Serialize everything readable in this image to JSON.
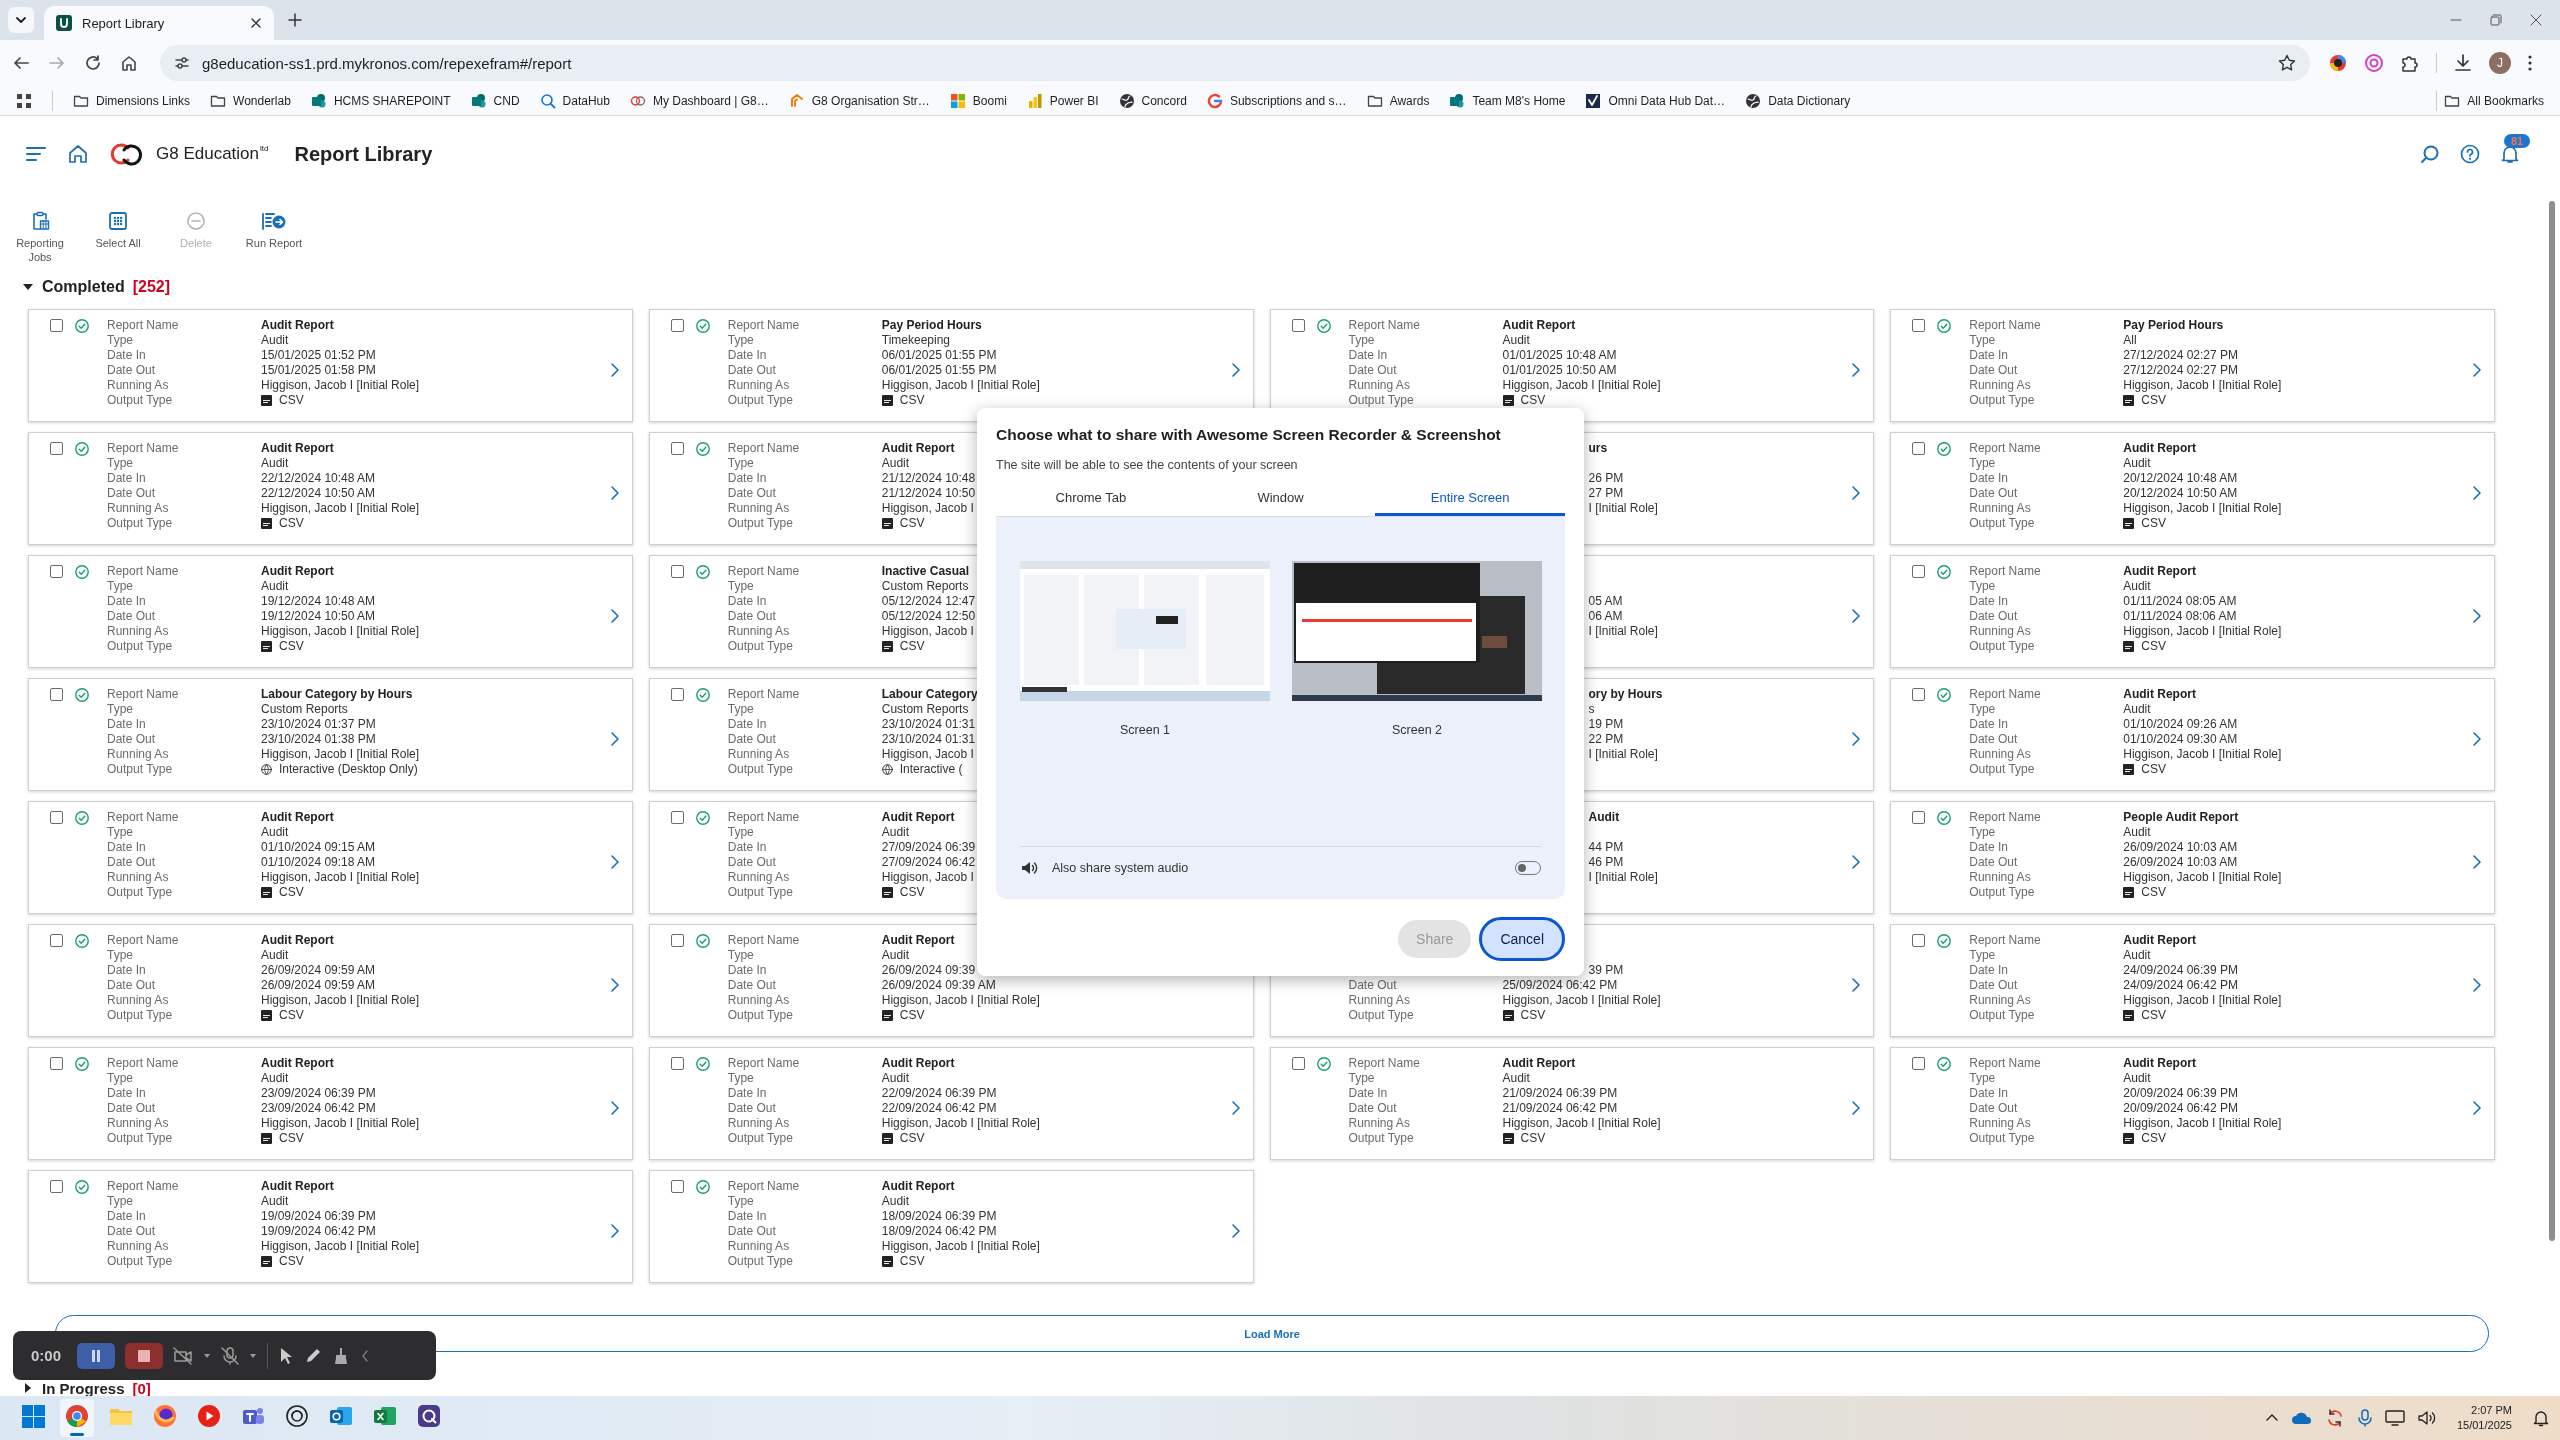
{
  "browser": {
    "tabs": [
      {
        "title": "Report Library",
        "selected": true
      }
    ],
    "url": "g8education-ss1.prd.mykronos.com/repexefram#/report",
    "profile_initial": "J",
    "bookmarks": [
      {
        "label": "Dimensions Links",
        "kind": "folder"
      },
      {
        "label": "Wonderlab",
        "kind": "folder"
      },
      {
        "label": "HCMS SHAREPOINT",
        "kind": "circles"
      },
      {
        "label": "CND",
        "kind": "circles"
      },
      {
        "label": "DataHub",
        "kind": "search"
      },
      {
        "label": "My Dashboard | G8…",
        "kind": "rings"
      },
      {
        "label": "G8 Organisation Str…",
        "kind": "chevron"
      },
      {
        "label": "Boomi",
        "kind": "squares"
      },
      {
        "label": "Power BI",
        "kind": "bars"
      },
      {
        "label": "Concord",
        "kind": "globe"
      },
      {
        "label": "Subscriptions and s…",
        "kind": "ring"
      },
      {
        "label": "Awards",
        "kind": "folder"
      },
      {
        "label": "Team M8's Home",
        "kind": "circles"
      },
      {
        "label": "Omni Data Hub Dat…",
        "kind": "checkmark"
      },
      {
        "label": "Data Dictionary",
        "kind": "globe"
      }
    ],
    "all_bookmarks": "All Bookmarks"
  },
  "app": {
    "brand": "G8 Education",
    "brand_suffix": "ltd",
    "title": "Report Library",
    "notification_count": "81"
  },
  "toolbar": [
    {
      "label": "Reporting Jobs",
      "kind": "jobs",
      "disabled": false
    },
    {
      "label": "Select All",
      "kind": "select-all",
      "disabled": false
    },
    {
      "label": "Delete",
      "kind": "delete",
      "disabled": true
    },
    {
      "label": "Run Report",
      "kind": "run",
      "disabled": false
    }
  ],
  "completed": {
    "title": "Completed",
    "count": "[252]",
    "expanded": true,
    "cards": [
      {
        "kind": "full",
        "checked": false,
        "done": true,
        "arrow": true,
        "fields": [
          {
            "label": "Report Name",
            "value": "Audit Report"
          },
          {
            "label": "Type",
            "value": "Audit"
          },
          {
            "label": "Date In",
            "value": "15/01/2025 01:52 PM"
          },
          {
            "label": "Date Out",
            "value": "15/01/2025 01:58 PM"
          },
          {
            "label": "Running As",
            "value": "Higgison, Jacob I [Initial Role]"
          },
          {
            "label": "Output Type",
            "value": "CSV",
            "kind": "csv"
          }
        ]
      },
      {
        "kind": "full",
        "checked": false,
        "done": true,
        "arrow": true,
        "fields": [
          {
            "label": "Report Name",
            "value": "Pay Period Hours"
          },
          {
            "label": "Type",
            "value": "Timekeeping"
          },
          {
            "label": "Date In",
            "value": "06/01/2025 01:55 PM"
          },
          {
            "label": "Date Out",
            "value": "06/01/2025 01:55 PM"
          },
          {
            "label": "Running As",
            "value": "Higgison, Jacob I [Initial Role]"
          },
          {
            "label": "Output Type",
            "value": "CSV",
            "kind": "csv"
          }
        ]
      },
      {
        "kind": "full",
        "checked": false,
        "done": true,
        "arrow": true,
        "fields": [
          {
            "label": "Report Name",
            "value": "Audit Report"
          },
          {
            "label": "Type",
            "value": "Audit"
          },
          {
            "label": "Date In",
            "value": "01/01/2025 10:48 AM"
          },
          {
            "label": "Date Out",
            "value": "01/01/2025 10:50 AM"
          },
          {
            "label": "Running As",
            "value": "Higgison, Jacob I [Initial Role]"
          },
          {
            "label": "Output Type",
            "value": "CSV",
            "kind": "csv"
          }
        ]
      },
      {
        "kind": "full",
        "checked": false,
        "done": true,
        "arrow": true,
        "fields": [
          {
            "label": "Report Name",
            "value": "Pay Period Hours"
          },
          {
            "label": "Type",
            "value": "All"
          },
          {
            "label": "Date In",
            "value": "27/12/2024 02:27 PM"
          },
          {
            "label": "Date Out",
            "value": "27/12/2024 02:27 PM"
          },
          {
            "label": "Running As",
            "value": "Higgison, Jacob I [Initial Role]"
          },
          {
            "label": "Output Type",
            "value": "CSV",
            "kind": "csv"
          }
        ]
      },
      {
        "kind": "full",
        "checked": false,
        "done": true,
        "arrow": true,
        "fields": [
          {
            "label": "Report Name",
            "value": "Audit Report"
          },
          {
            "label": "Type",
            "value": "Audit"
          },
          {
            "label": "Date In",
            "value": "22/12/2024 10:48 AM"
          },
          {
            "label": "Date Out",
            "value": "22/12/2024 10:50 AM"
          },
          {
            "label": "Running As",
            "value": "Higgison, Jacob I [Initial Role]"
          },
          {
            "label": "Output Type",
            "value": "CSV",
            "kind": "csv"
          }
        ]
      },
      {
        "kind": "full",
        "checked": false,
        "done": true,
        "arrow": false,
        "fields": [
          {
            "label": "Report Name",
            "value": "Audit Report"
          },
          {
            "label": "Type",
            "value": "Audit"
          },
          {
            "label": "Date In",
            "value": "21/12/2024 10:48"
          },
          {
            "label": "Date Out",
            "value": "21/12/2024 10:50"
          },
          {
            "label": "Running As",
            "value": "Higgison, Jacob I"
          },
          {
            "label": "Output Type",
            "value": "CSV",
            "kind": "csv"
          }
        ]
      },
      {
        "kind": "partial",
        "arrow": true,
        "fields": [
          {
            "kind": "fragment",
            "value": "urs"
          },
          {
            "kind": "hidden"
          },
          {
            "kind": "fragment",
            "value": "26 PM"
          },
          {
            "kind": "fragment",
            "value": "27 PM"
          },
          {
            "kind": "fragment",
            "value": "I [Initial Role]"
          }
        ]
      },
      {
        "kind": "full",
        "checked": false,
        "done": true,
        "arrow": true,
        "fields": [
          {
            "label": "Report Name",
            "value": "Audit Report"
          },
          {
            "label": "Type",
            "value": "Audit"
          },
          {
            "label": "Date In",
            "value": "20/12/2024 10:48 AM"
          },
          {
            "label": "Date Out",
            "value": "20/12/2024 10:50 AM"
          },
          {
            "label": "Running As",
            "value": "Higgison, Jacob I [Initial Role]"
          },
          {
            "label": "Output Type",
            "value": "CSV",
            "kind": "csv"
          }
        ]
      },
      {
        "kind": "full",
        "checked": false,
        "done": true,
        "arrow": true,
        "fields": [
          {
            "label": "Report Name",
            "value": "Audit Report"
          },
          {
            "label": "Type",
            "value": "Audit"
          },
          {
            "label": "Date In",
            "value": "19/12/2024 10:48 AM"
          },
          {
            "label": "Date Out",
            "value": "19/12/2024 10:50 AM"
          },
          {
            "label": "Running As",
            "value": "Higgison, Jacob I [Initial Role]"
          },
          {
            "label": "Output Type",
            "value": "CSV",
            "kind": "csv"
          }
        ]
      },
      {
        "kind": "full",
        "checked": false,
        "done": true,
        "arrow": false,
        "fields": [
          {
            "label": "Report Name",
            "value": "Inactive Casual"
          },
          {
            "label": "Type",
            "value": "Custom Reports"
          },
          {
            "label": "Date In",
            "value": "05/12/2024 12:47"
          },
          {
            "label": "Date Out",
            "value": "05/12/2024 12:50"
          },
          {
            "label": "Running As",
            "value": "Higgison, Jacob I"
          },
          {
            "label": "Output Type",
            "value": "CSV",
            "kind": "csv"
          }
        ]
      },
      {
        "kind": "partial",
        "arrow": true,
        "fields": [
          {
            "kind": "hidden"
          },
          {
            "kind": "hidden"
          },
          {
            "kind": "fragment",
            "value": "05 AM"
          },
          {
            "kind": "fragment",
            "value": "06 AM"
          },
          {
            "kind": "fragment",
            "value": "I [Initial Role]"
          }
        ]
      },
      {
        "kind": "full",
        "checked": false,
        "done": true,
        "arrow": true,
        "fields": [
          {
            "label": "Report Name",
            "value": "Audit Report"
          },
          {
            "label": "Type",
            "value": "Audit"
          },
          {
            "label": "Date In",
            "value": "01/11/2024 08:05 AM"
          },
          {
            "label": "Date Out",
            "value": "01/11/2024 08:06 AM"
          },
          {
            "label": "Running As",
            "value": "Higgison, Jacob I [Initial Role]"
          },
          {
            "label": "Output Type",
            "value": "CSV",
            "kind": "csv"
          }
        ]
      },
      {
        "kind": "full",
        "checked": false,
        "done": true,
        "arrow": true,
        "fields": [
          {
            "label": "Report Name",
            "value": "Labour Category by Hours"
          },
          {
            "label": "Type",
            "value": "Custom Reports"
          },
          {
            "label": "Date In",
            "value": "23/10/2024 01:37 PM"
          },
          {
            "label": "Date Out",
            "value": "23/10/2024 01:38 PM"
          },
          {
            "label": "Running As",
            "value": "Higgison, Jacob I [Initial Role]"
          },
          {
            "label": "Output Type",
            "value": "Interactive (Desktop Only)",
            "kind": "interactive"
          }
        ]
      },
      {
        "kind": "full",
        "checked": false,
        "done": true,
        "arrow": false,
        "fields": [
          {
            "label": "Report Name",
            "value": "Labour Category"
          },
          {
            "label": "Type",
            "value": "Custom Reports"
          },
          {
            "label": "Date In",
            "value": "23/10/2024 01:31"
          },
          {
            "label": "Date Out",
            "value": "23/10/2024 01:31"
          },
          {
            "label": "Running As",
            "value": "Higgison, Jacob I"
          },
          {
            "label": "Output Type",
            "value": "Interactive (",
            "kind": "interactive"
          }
        ]
      },
      {
        "kind": "partial",
        "arrow": true,
        "fields": [
          {
            "kind": "fragment",
            "value": "ory by Hours"
          },
          {
            "kind": "fragment",
            "value": "s"
          },
          {
            "kind": "fragment",
            "value": "19 PM"
          },
          {
            "kind": "fragment",
            "value": "22 PM"
          },
          {
            "kind": "fragment",
            "value": "I [Initial Role]"
          }
        ]
      },
      {
        "kind": "full",
        "checked": false,
        "done": true,
        "arrow": true,
        "fields": [
          {
            "label": "Report Name",
            "value": "Audit Report"
          },
          {
            "label": "Type",
            "value": "Audit"
          },
          {
            "label": "Date In",
            "value": "01/10/2024 09:26 AM"
          },
          {
            "label": "Date Out",
            "value": "01/10/2024 09:30 AM"
          },
          {
            "label": "Running As",
            "value": "Higgison, Jacob I [Initial Role]"
          },
          {
            "label": "Output Type",
            "value": "CSV",
            "kind": "csv"
          }
        ]
      },
      {
        "kind": "full",
        "checked": false,
        "done": true,
        "arrow": true,
        "fields": [
          {
            "label": "Report Name",
            "value": "Audit Report"
          },
          {
            "label": "Type",
            "value": "Audit"
          },
          {
            "label": "Date In",
            "value": "01/10/2024 09:15 AM"
          },
          {
            "label": "Date Out",
            "value": "01/10/2024 09:18 AM"
          },
          {
            "label": "Running As",
            "value": "Higgison, Jacob I [Initial Role]"
          },
          {
            "label": "Output Type",
            "value": "CSV",
            "kind": "csv"
          }
        ]
      },
      {
        "kind": "full",
        "checked": false,
        "done": true,
        "arrow": false,
        "fields": [
          {
            "label": "Report Name",
            "value": "Audit Report"
          },
          {
            "label": "Type",
            "value": "Audit"
          },
          {
            "label": "Date In",
            "value": "27/09/2024 06:39"
          },
          {
            "label": "Date Out",
            "value": "27/09/2024 06:42"
          },
          {
            "label": "Running As",
            "value": "Higgison, Jacob I"
          },
          {
            "label": "Output Type",
            "value": "CSV",
            "kind": "csv"
          }
        ]
      },
      {
        "kind": "partial",
        "arrow": true,
        "fields": [
          {
            "kind": "fragment",
            "value": "Audit"
          },
          {
            "kind": "hidden"
          },
          {
            "kind": "fragment",
            "value": "44 PM"
          },
          {
            "kind": "fragment",
            "value": "46 PM"
          },
          {
            "kind": "fragment",
            "value": "I [Initial Role]"
          }
        ]
      },
      {
        "kind": "full",
        "checked": false,
        "done": true,
        "arrow": true,
        "fields": [
          {
            "label": "Report Name",
            "value": "People Audit Report"
          },
          {
            "label": "Type",
            "value": "Audit"
          },
          {
            "label": "Date In",
            "value": "26/09/2024 10:03 AM"
          },
          {
            "label": "Date Out",
            "value": "26/09/2024 10:03 AM"
          },
          {
            "label": "Running As",
            "value": "Higgison, Jacob I [Initial Role]"
          },
          {
            "label": "Output Type",
            "value": "CSV",
            "kind": "csv"
          }
        ]
      },
      {
        "kind": "full",
        "checked": false,
        "done": true,
        "arrow": true,
        "fields": [
          {
            "label": "Report Name",
            "value": "Audit Report"
          },
          {
            "label": "Type",
            "value": "Audit"
          },
          {
            "label": "Date In",
            "value": "26/09/2024 09:59 AM"
          },
          {
            "label": "Date Out",
            "value": "26/09/2024 09:59 AM"
          },
          {
            "label": "Running As",
            "value": "Higgison, Jacob I [Initial Role]"
          },
          {
            "label": "Output Type",
            "value": "CSV",
            "kind": "csv"
          }
        ]
      },
      {
        "kind": "full",
        "checked": false,
        "done": true,
        "arrow": false,
        "fields": [
          {
            "label": "Report Name",
            "value": "Audit Report"
          },
          {
            "label": "Type",
            "value": "Audit"
          },
          {
            "label": "Date In",
            "value": "26/09/2024 09:39"
          },
          {
            "label": "Date Out",
            "value": "26/09/2024 09:39 AM"
          },
          {
            "label": "Running As",
            "value": "Higgison, Jacob I [Initial Role]"
          },
          {
            "label": "Output Type",
            "value": "CSV",
            "kind": "csv"
          }
        ]
      },
      {
        "kind": "partial",
        "arrow": true,
        "fields": [
          {
            "kind": "hidden"
          },
          {
            "kind": "hidden"
          },
          {
            "kind": "fragment",
            "value": "39 PM"
          },
          {
            "kind": "full",
            "label": "Date Out",
            "value": "25/09/2024 06:42 PM"
          },
          {
            "kind": "full",
            "label": "Running As",
            "value": "Higgison, Jacob I [Initial Role]"
          },
          {
            "kind": "csv",
            "label": "Output Type",
            "value": "CSV"
          }
        ]
      },
      {
        "kind": "full",
        "checked": false,
        "done": true,
        "arrow": true,
        "fields": [
          {
            "label": "Report Name",
            "value": "Audit Report"
          },
          {
            "label": "Type",
            "value": "Audit"
          },
          {
            "label": "Date In",
            "value": "24/09/2024 06:39 PM"
          },
          {
            "label": "Date Out",
            "value": "24/09/2024 06:42 PM"
          },
          {
            "label": "Running As",
            "value": "Higgison, Jacob I [Initial Role]"
          },
          {
            "label": "Output Type",
            "value": "CSV",
            "kind": "csv"
          }
        ]
      },
      {
        "kind": "full",
        "checked": false,
        "done": true,
        "arrow": true,
        "fields": [
          {
            "label": "Report Name",
            "value": "Audit Report"
          },
          {
            "label": "Type",
            "value": "Audit"
          },
          {
            "label": "Date In",
            "value": "23/09/2024 06:39 PM"
          },
          {
            "label": "Date Out",
            "value": "23/09/2024 06:42 PM"
          },
          {
            "label": "Running As",
            "value": "Higgison, Jacob I [Initial Role]"
          },
          {
            "label": "Output Type",
            "value": "CSV",
            "kind": "csv"
          }
        ]
      },
      {
        "kind": "full",
        "checked": false,
        "done": true,
        "arrow": true,
        "fields": [
          {
            "label": "Report Name",
            "value": "Audit Report"
          },
          {
            "label": "Type",
            "value": "Audit"
          },
          {
            "label": "Date In",
            "value": "22/09/2024 06:39 PM"
          },
          {
            "label": "Date Out",
            "value": "22/09/2024 06:42 PM"
          },
          {
            "label": "Running As",
            "value": "Higgison, Jacob I [Initial Role]"
          },
          {
            "label": "Output Type",
            "value": "CSV",
            "kind": "csv"
          }
        ]
      },
      {
        "kind": "full",
        "checked": false,
        "done": true,
        "arrow": true,
        "fields": [
          {
            "label": "Report Name",
            "value": "Audit Report"
          },
          {
            "label": "Type",
            "value": "Audit"
          },
          {
            "label": "Date In",
            "value": "21/09/2024 06:39 PM"
          },
          {
            "label": "Date Out",
            "value": "21/09/2024 06:42 PM"
          },
          {
            "label": "Running As",
            "value": "Higgison, Jacob I [Initial Role]"
          },
          {
            "label": "Output Type",
            "value": "CSV",
            "kind": "csv"
          }
        ]
      },
      {
        "kind": "full",
        "checked": false,
        "done": true,
        "arrow": true,
        "fields": [
          {
            "label": "Report Name",
            "value": "Audit Report"
          },
          {
            "label": "Type",
            "value": "Audit"
          },
          {
            "label": "Date In",
            "value": "20/09/2024 06:39 PM"
          },
          {
            "label": "Date Out",
            "value": "20/09/2024 06:42 PM"
          },
          {
            "label": "Running As",
            "value": "Higgison, Jacob I [Initial Role]"
          },
          {
            "label": "Output Type",
            "value": "CSV",
            "kind": "csv"
          }
        ]
      },
      {
        "kind": "full",
        "checked": false,
        "done": true,
        "arrow": true,
        "fields": [
          {
            "label": "Report Name",
            "value": "Audit Report"
          },
          {
            "label": "Type",
            "value": "Audit"
          },
          {
            "label": "Date In",
            "value": "19/09/2024 06:39 PM"
          },
          {
            "label": "Date Out",
            "value": "19/09/2024 06:42 PM"
          },
          {
            "label": "Running As",
            "value": "Higgison, Jacob I [Initial Role]"
          },
          {
            "label": "Output Type",
            "value": "CSV",
            "kind": "csv"
          }
        ]
      },
      {
        "kind": "full",
        "checked": false,
        "done": true,
        "arrow": true,
        "fields": [
          {
            "label": "Report Name",
            "value": "Audit Report"
          },
          {
            "label": "Type",
            "value": "Audit"
          },
          {
            "label": "Date In",
            "value": "18/09/2024 06:39 PM"
          },
          {
            "label": "Date Out",
            "value": "18/09/2024 06:42 PM"
          },
          {
            "label": "Running As",
            "value": "Higgison, Jacob I [Initial Role]"
          },
          {
            "label": "Output Type",
            "value": "CSV",
            "kind": "csv"
          }
        ]
      }
    ]
  },
  "load_more": "Load More",
  "in_progress": {
    "title": "In Progress",
    "count": "[0]",
    "expanded": false
  },
  "share_dialog": {
    "title": "Choose what to share with Awesome Screen Recorder & Screenshot",
    "subtitle": "The site will be able to see the contents of your screen",
    "tabs": [
      {
        "label": "Chrome Tab",
        "selected": false
      },
      {
        "label": "Window",
        "selected": false
      },
      {
        "label": "Entire Screen",
        "selected": true
      }
    ],
    "screens": [
      {
        "label": "Screen 1",
        "kind": "light"
      },
      {
        "label": "Screen 2",
        "kind": "dark"
      }
    ],
    "audio": {
      "label": "Also share system audio",
      "on": false
    },
    "buttons": [
      {
        "label": "Share",
        "kind": "secondary",
        "disabled": true
      },
      {
        "label": "Cancel",
        "kind": "primary",
        "disabled": false
      }
    ]
  },
  "recorder": {
    "time": "0:00"
  },
  "taskbar": {
    "apps": [
      {
        "kind": "start",
        "selected": false
      },
      {
        "kind": "chrome",
        "selected": true
      },
      {
        "kind": "explorer",
        "selected": false
      },
      {
        "kind": "firefox",
        "selected": false
      },
      {
        "kind": "play",
        "selected": false
      },
      {
        "kind": "teams",
        "selected": false
      },
      {
        "kind": "knot",
        "selected": false
      },
      {
        "kind": "mail",
        "selected": false
      },
      {
        "kind": "sheet",
        "selected": false
      },
      {
        "kind": "app",
        "selected": false
      }
    ],
    "time": "2:07 PM",
    "date": "15/01/2025"
  }
}
